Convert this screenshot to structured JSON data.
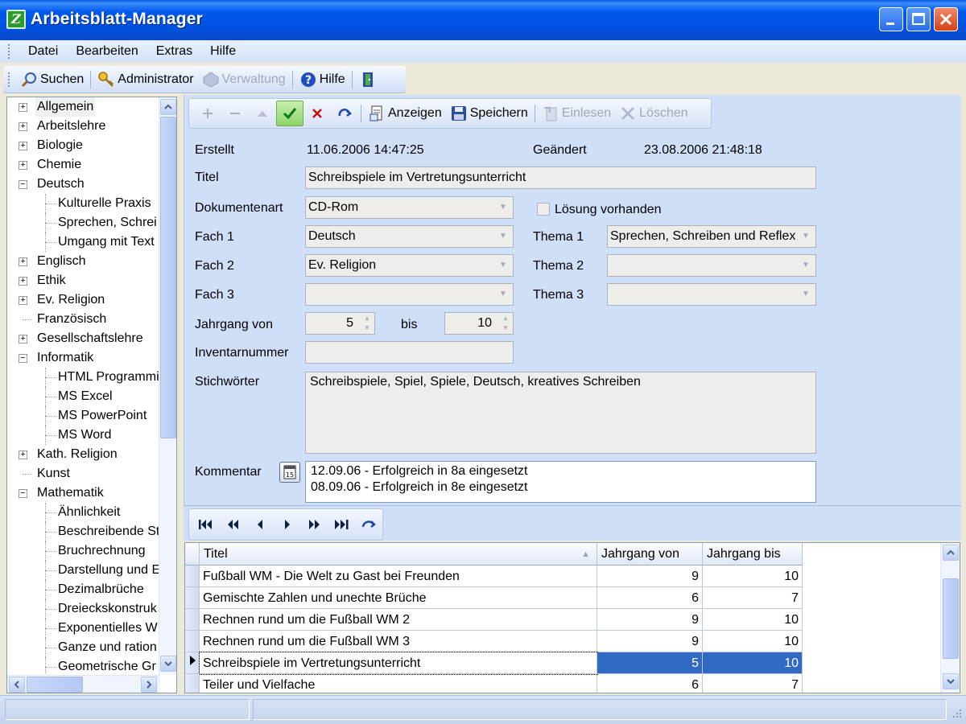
{
  "window": {
    "title": "Arbeitsblatt-Manager",
    "app_icon": "spreadsheet-icon",
    "controls": [
      "minimize",
      "maximize",
      "close"
    ]
  },
  "menu": {
    "items": [
      "Datei",
      "Bearbeiten",
      "Extras",
      "Hilfe"
    ]
  },
  "main_toolbar": {
    "search_label": "Suchen",
    "admin_label": "Administrator",
    "admin_manage_label": "Verwaltung",
    "help_label": "Hilfe"
  },
  "record_toolbar": {
    "show_label": "Anzeigen",
    "save_label": "Speichern",
    "import_label": "Einlesen",
    "delete_label": "Löschen"
  },
  "tree": {
    "items": [
      {
        "label": "Allgemein",
        "level": 0,
        "expander": "+",
        "selected": true
      },
      {
        "label": "Arbeitslehre",
        "level": 0,
        "expander": "+"
      },
      {
        "label": "Biologie",
        "level": 0,
        "expander": "+"
      },
      {
        "label": "Chemie",
        "level": 0,
        "expander": "+"
      },
      {
        "label": "Deutsch",
        "level": 0,
        "expander": "−"
      },
      {
        "label": "Kulturelle Praxis",
        "level": 1
      },
      {
        "label": "Sprechen, Schrei",
        "level": 1
      },
      {
        "label": "Umgang mit Text",
        "level": 1
      },
      {
        "label": "Englisch",
        "level": 0,
        "expander": "+"
      },
      {
        "label": "Ethik",
        "level": 0,
        "expander": "+"
      },
      {
        "label": "Ev. Religion",
        "level": 0,
        "expander": "+"
      },
      {
        "label": "Französisch",
        "level": 0
      },
      {
        "label": "Gesellschaftslehre",
        "level": 0,
        "expander": "+"
      },
      {
        "label": "Informatik",
        "level": 0,
        "expander": "−"
      },
      {
        "label": "HTML Programmi",
        "level": 1
      },
      {
        "label": "MS Excel",
        "level": 1
      },
      {
        "label": "MS PowerPoint",
        "level": 1
      },
      {
        "label": "MS Word",
        "level": 1
      },
      {
        "label": "Kath. Religion",
        "level": 0,
        "expander": "+"
      },
      {
        "label": "Kunst",
        "level": 0
      },
      {
        "label": "Mathematik",
        "level": 0,
        "expander": "−"
      },
      {
        "label": "Ähnlichkeit",
        "level": 1
      },
      {
        "label": "Beschreibende St",
        "level": 1
      },
      {
        "label": "Bruchrechnung",
        "level": 1
      },
      {
        "label": "Darstellung und E",
        "level": 1
      },
      {
        "label": "Dezimalbrüche",
        "level": 1
      },
      {
        "label": "Dreieckskonstruk",
        "level": 1
      },
      {
        "label": "Exponentielles W",
        "level": 1
      },
      {
        "label": "Ganze und ration",
        "level": 1
      },
      {
        "label": "Geometrische Gr",
        "level": 1
      }
    ]
  },
  "form": {
    "created_label": "Erstellt",
    "created_value": "11.06.2006 14:47:25",
    "changed_label": "Geändert",
    "changed_value": "23.08.2006 21:48:18",
    "title_label": "Titel",
    "title_value": "Schreibspiele im Vertretungsunterricht",
    "doctype_label": "Dokumentenart",
    "doctype_value": "CD-Rom",
    "solution_label": "Lösung vorhanden",
    "solution_checked": false,
    "subject1_label": "Fach 1",
    "subject1_value": "Deutsch",
    "topic1_label": "Thema 1",
    "topic1_value": "Sprechen, Schreiben und Reflex",
    "subject2_label": "Fach 2",
    "subject2_value": "Ev. Religion",
    "topic2_label": "Thema 2",
    "topic2_value": "",
    "subject3_label": "Fach 3",
    "subject3_value": "",
    "topic3_label": "Thema 3",
    "topic3_value": "",
    "grade_from_label": "Jahrgang von",
    "grade_from_value": "5",
    "grade_to_label": "bis",
    "grade_to_value": "10",
    "inventory_label": "Inventarnummer",
    "inventory_value": "",
    "keywords_label": "Stichwörter",
    "keywords_value": "Schreibspiele, Spiel, Spiele, Deutsch, kreatives Schreiben",
    "comment_label": "Kommentar",
    "comment_lines": [
      "12.09.06 - Erfolgreich in 8a eingesetzt",
      "08.09.06 - Erfolgreich in 8e eingesetzt"
    ]
  },
  "grid": {
    "columns": [
      "Titel",
      "Jahrgang von",
      "Jahrgang bis"
    ],
    "rows": [
      {
        "title": "Fußball WM - Die Welt zu Gast bei Freunden",
        "from": "9",
        "to": "10",
        "current": false
      },
      {
        "title": "Gemischte Zahlen und unechte Brüche",
        "from": "6",
        "to": "7",
        "current": false
      },
      {
        "title": "Rechnen rund um die Fußball WM 2",
        "from": "9",
        "to": "10",
        "current": false
      },
      {
        "title": "Rechnen rund um die Fußball WM 3",
        "from": "9",
        "to": "10",
        "current": false
      },
      {
        "title": "Schreibspiele im Vertretungsunterricht",
        "from": "5",
        "to": "10",
        "current": true
      },
      {
        "title": "Teiler und Vielfache",
        "from": "6",
        "to": "7",
        "current": false
      }
    ]
  },
  "colors": {
    "titlebar": "#0058ee",
    "panel_bg": "#cfdff7",
    "selection": "#316ac5"
  }
}
